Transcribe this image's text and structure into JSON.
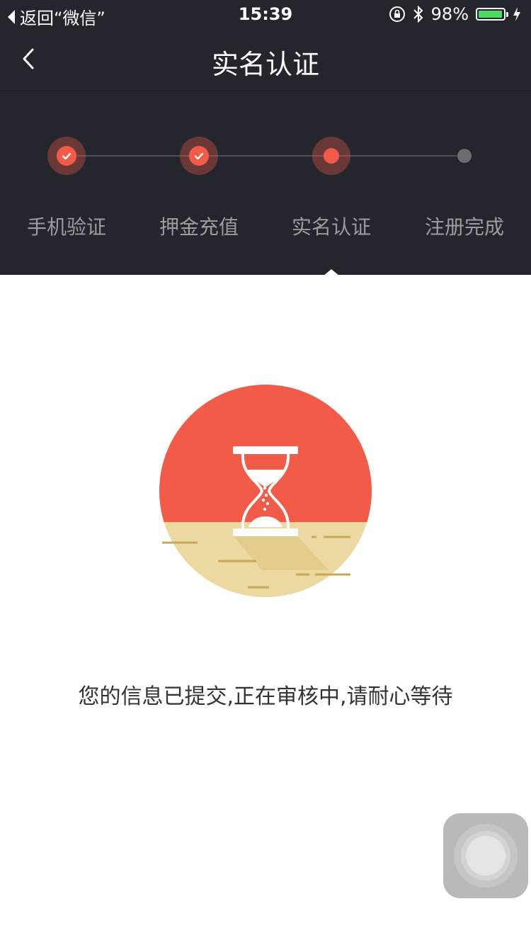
{
  "status_bar": {
    "back_app_label": "返回“微信”",
    "time": "15:39",
    "battery_percent": "98%",
    "battery_level": 0.98
  },
  "nav": {
    "title": "实名认证"
  },
  "steps": [
    {
      "label": "手机验证",
      "state": "done"
    },
    {
      "label": "押金充值",
      "state": "done"
    },
    {
      "label": "实名认证",
      "state": "current"
    },
    {
      "label": "注册完成",
      "state": "pending"
    }
  ],
  "message": "您的信息已提交,正在审核中,请耐心等待",
  "colors": {
    "header_bg": "#23262d",
    "accent": "#f15b48",
    "sand": "#ecd9a1",
    "sand_line": "#c9a65a"
  },
  "icons": {
    "status_back": "back-arrow-icon",
    "nav_back": "chevron-left-icon",
    "rotation_lock": "rotation-lock-icon",
    "bluetooth": "bluetooth-icon",
    "charging": "charging-bolt-icon",
    "illustration": "hourglass-icon"
  }
}
